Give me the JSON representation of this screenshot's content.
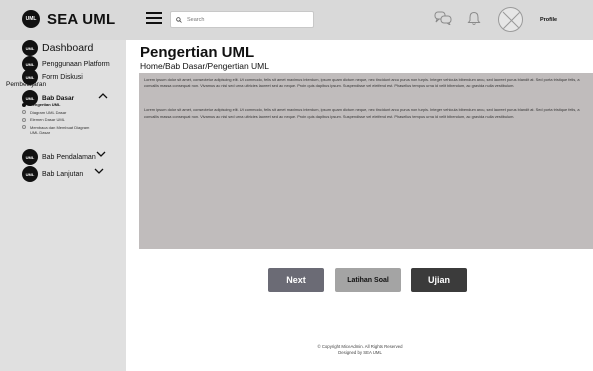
{
  "app": {
    "badge": "UML",
    "name": "SEA UML"
  },
  "header": {
    "search_placeholder": "Search",
    "profile_label": "Profile",
    "icons": [
      "menu-icon",
      "search-icon",
      "chat-icon",
      "bell-icon",
      "avatar-icon"
    ]
  },
  "sidebar": {
    "dashboard": "Dashboard",
    "platform": "Penggunaan Platform",
    "forum": "Form Diskusi",
    "category": "Pembelajaran",
    "bab_dasar": "Bab Dasar",
    "sub_items": [
      "Pengertian UML",
      "Diagram UML Dasar",
      "Elemen Dasar UML",
      "Membaca dan Membuat Diagram UML Dasar"
    ],
    "active_sub_index": 0,
    "bab_pendalaman": "Bab Pendalaman",
    "bab_lanjutan": "Bab Lanjutan"
  },
  "main": {
    "title": "Pengertian UML",
    "breadcrumb": "Home/Bab Dasar/Pengertian UML",
    "paragraphs": [
      "Lorem ipsum dolor sit amet, consectetur adipiscing elit. Ut commodo, felis sit amet maximus interdum, ipsum quam dictum neque, nec tincidunt arcu purus non turpis. Integer vehicula bibendum arcu, sed laoreet purus blandit at. Sed porta tristique felis, a convallis massa consequat non. Vivamus ac nisl sed urna ultricies laoreet sed ac neque. Proin quis dapibus ipsum. Suspendisse vel eleifend est. Phasellus tempus urna id velit bibendum, ac gravida nulla vestibulum.",
      "Lorem ipsum dolor sit amet, consectetur adipiscing elit. Ut commodo, felis sit amet maximus interdum, ipsum quam dictum neque, nec tincidunt arcu purus non turpis. Integer vehicula bibendum arcu, sed laoreet purus blandit at. Sed porta tristique felis, a convallis massa consequat non. Vivamus ac nisl sed urna ultricies laoreet sed ac neque. Proin quis dapibus ipsum. Suspendisse vel eleifend est. Phasellus tempus urna id velit bibendum, ac gravida nulla vestibulum."
    ],
    "buttons": {
      "next": "Next",
      "latihan": "Latihan Soal",
      "ujian": "Ujian"
    }
  },
  "footer": {
    "copyright": "© Copyright MiceAdmin. All Rights Reserved",
    "designed_by": "Designed by SEA UML"
  },
  "colors": {
    "topbar": "#d9d9d9",
    "sidebar": "#e0e0e0",
    "content_box": "#c0bcbc",
    "next_button": "#6b6b75",
    "latihan_button": "#a4a4a4",
    "ujian_button": "#3b3b3b"
  }
}
